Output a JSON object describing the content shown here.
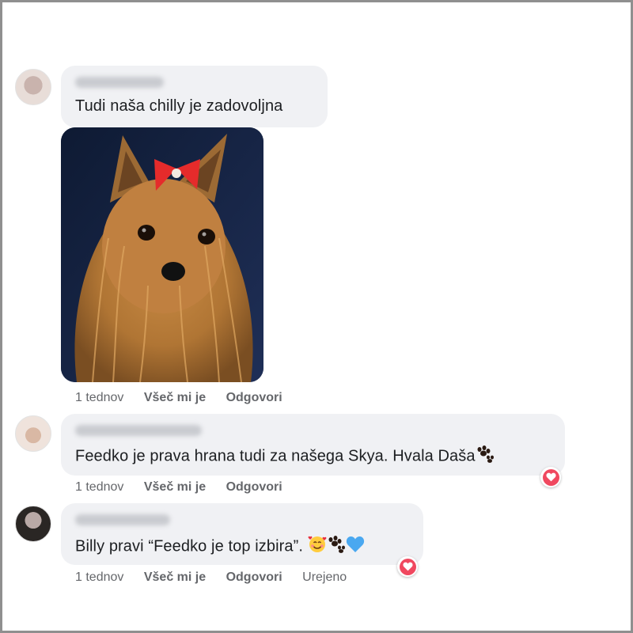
{
  "comments": [
    {
      "text": "Tudi naša chilly je zadovoljna",
      "has_photo": true,
      "photo": "yorkshire-terrier-with-red-bow",
      "time": "1 tednov",
      "like_label": "Všeč mi je",
      "reply_label": "Odgovori",
      "reaction": null
    },
    {
      "text": "Feedko je prava hrana tudi za našega Skya. Hvala Daša",
      "trailing_emoji": [
        "paw-prints-icon"
      ],
      "time": "1 tednov",
      "like_label": "Všeč mi je",
      "reply_label": "Odgovori",
      "reaction": "heart-icon"
    },
    {
      "text": "Billy pravi “Feedko je top izbira”.",
      "trailing_emoji": [
        "smiling-face-with-hearts-icon",
        "paw-prints-icon",
        "blue-heart-icon"
      ],
      "time": "1 tednov",
      "like_label": "Všeč mi je",
      "reply_label": "Odgovori",
      "edited_label": "Urejeno",
      "reaction": "heart-icon"
    }
  ],
  "colors": {
    "bubble": "#f0f1f4",
    "text": "#1c1e21",
    "meta": "#65676b",
    "reaction": "#f0485f",
    "frame": "#8f8f8f"
  }
}
